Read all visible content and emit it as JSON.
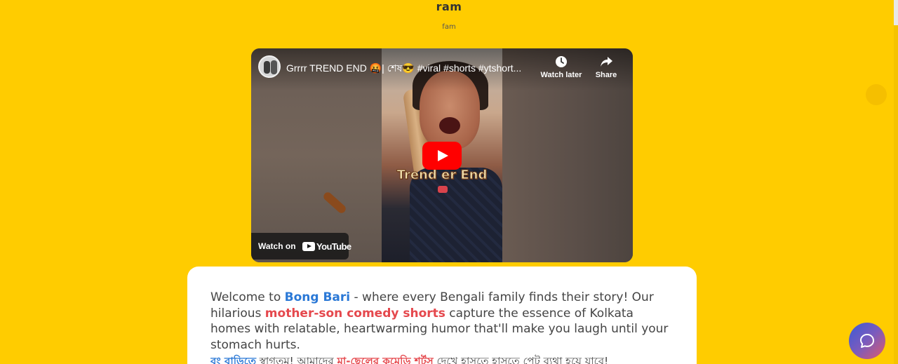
{
  "header": {
    "title": "ram",
    "subtitle": "fam"
  },
  "video": {
    "title": "Grrrr TREND END 🤬| শেষ😎 #viral #shorts #ytshort...",
    "watch_later_label": "Watch later",
    "share_label": "Share",
    "overlay_caption": "Trend er End",
    "overlay_emoji": "🤬",
    "watch_on_label": "Watch on",
    "youtube_label": "YouTube"
  },
  "card": {
    "intro": {
      "part1": "Welcome to ",
      "brand": "Bong Bari",
      "part2": " - where every Bengali family finds their story! Our hilarious ",
      "highlight": "mother-son comedy shorts",
      "part3": " capture the essence of Kolkata homes with relatable, heartwarming humor that'll make you laugh until your stomach hurts."
    },
    "bengali": {
      "brand": "বং বাড়িতে",
      "part1": " স্বাগতম! আমাদের ",
      "highlight": "মা-ছেলের কমেডি শর্টস",
      "part2": " দেখে হাসতে হাসতে পেট ব্যথা হয়ে যাবে!"
    }
  },
  "colors": {
    "background": "#ffcc00",
    "brand_blue": "#2a78d6",
    "highlight_red": "#e5484d",
    "youtube_red": "#ff0000"
  },
  "icons": [
    "clock-icon",
    "share-icon",
    "play-icon",
    "youtube-logo-icon",
    "chat-icon"
  ]
}
